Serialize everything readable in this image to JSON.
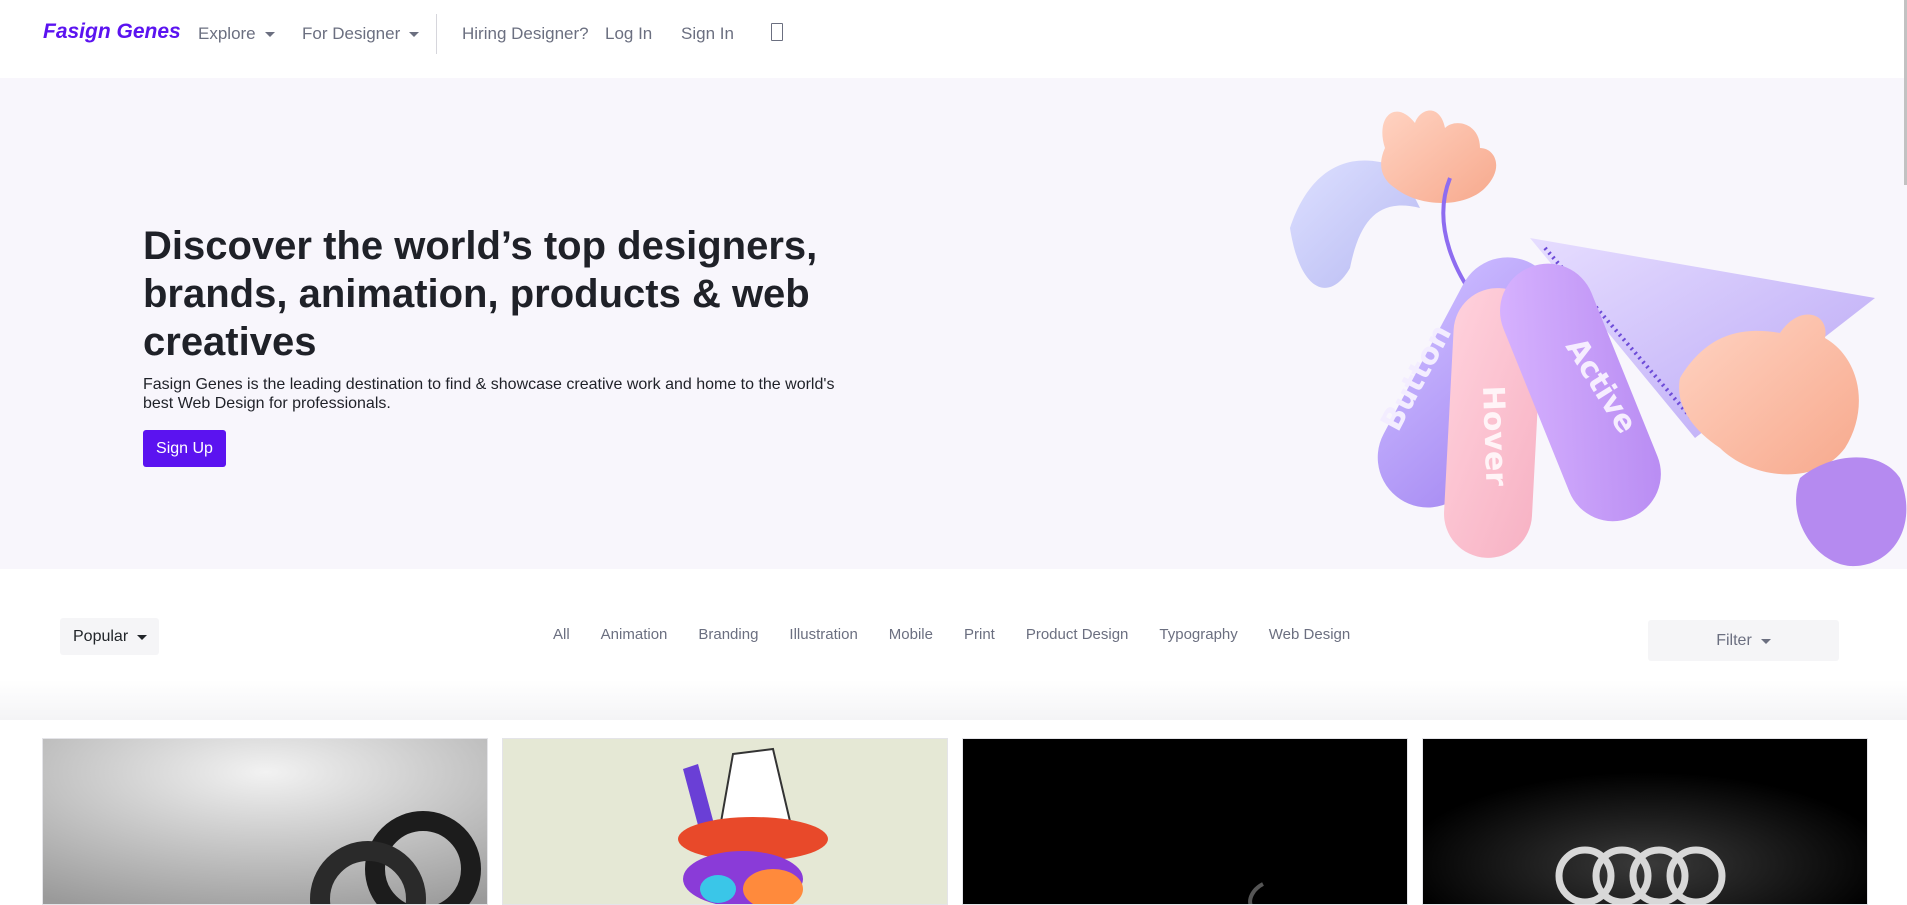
{
  "nav": {
    "brand": "Fasign Genes",
    "explore": "Explore",
    "for_designer": "For Designer",
    "hiring": "Hiring Designer?",
    "login": "Log In",
    "signin": "Sign In",
    "search_icon": "search-icon"
  },
  "hero": {
    "title": "Discover the world’s top designers, brands, animation, products & web creatives",
    "description": "Fasign Genes is the leading destination to find & showcase creative work and home to the world's best Web Design for professionals.",
    "signup": "Sign Up",
    "tags": [
      "Button",
      "Hover",
      "Active"
    ]
  },
  "filters": {
    "sort": "Popular",
    "categories": [
      "All",
      "Animation",
      "Branding",
      "Illustration",
      "Mobile",
      "Print",
      "Product Design",
      "Typography",
      "Web Design"
    ],
    "filter": "Filter"
  },
  "colors": {
    "accent": "#5b13f0",
    "hero_bg": "#f8f6fc"
  }
}
